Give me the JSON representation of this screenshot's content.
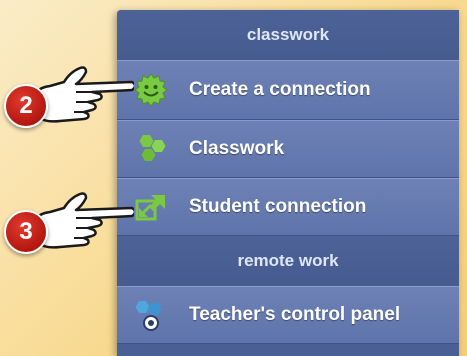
{
  "menu": {
    "sections": [
      {
        "title": "classwork",
        "items": [
          {
            "label": "Create a connection",
            "icon": "smiley-gear-icon",
            "color": "#7ac943"
          },
          {
            "label": "Classwork",
            "icon": "hexagon-cluster-icon",
            "color": "#7ac943"
          },
          {
            "label": "Student connection",
            "icon": "expand-arrows-icon",
            "color": "#7ac943"
          }
        ]
      },
      {
        "title": "remote work",
        "items": [
          {
            "label": "Teacher's control panel",
            "icon": "teacher-panel-icon",
            "color": "#4fa7e0"
          }
        ]
      }
    ]
  },
  "callouts": [
    {
      "number": "2"
    },
    {
      "number": "3"
    }
  ],
  "colors": {
    "menu_bg": "#4a5f94",
    "item_bg": "#6678ae",
    "badge_red": "#c8221a",
    "page_bg": "#f8d98f"
  }
}
